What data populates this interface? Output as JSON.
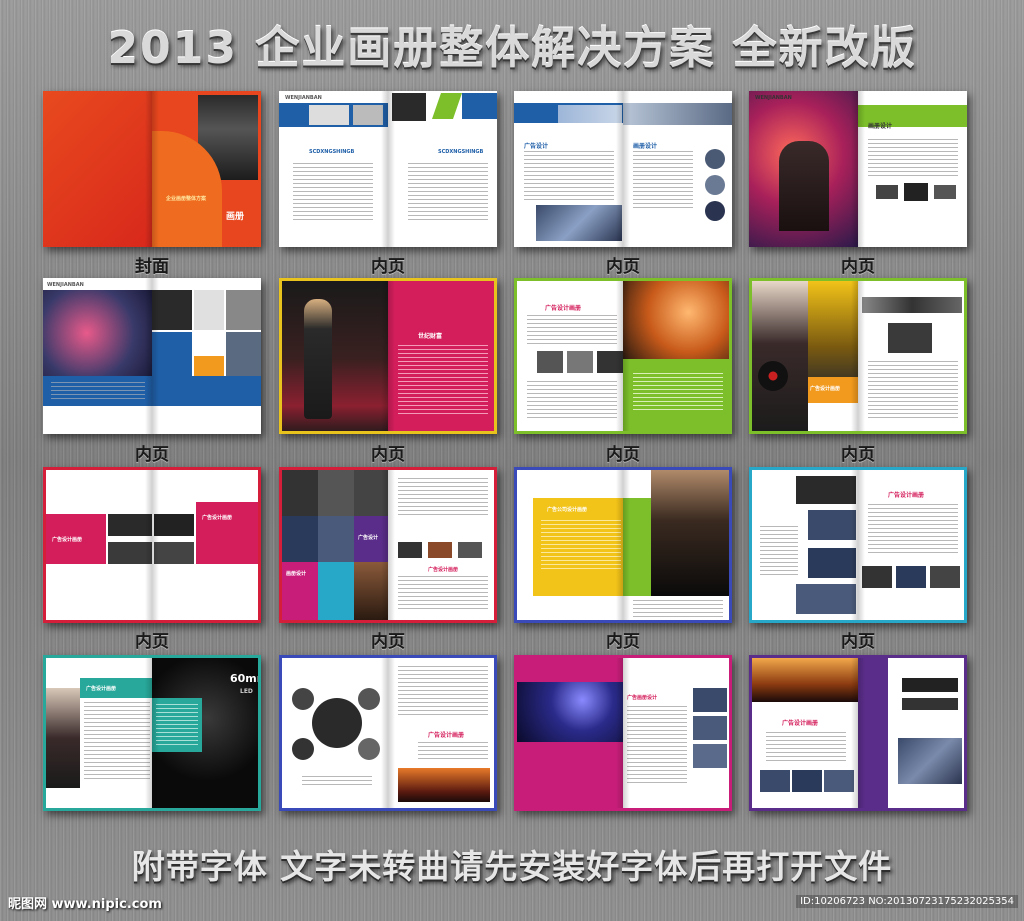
{
  "headline": "2013 企业画册整体解决方案  全新改版",
  "footer": "附带字体  文字未转曲请先安装好字体后再打开文件",
  "watermark": {
    "left": "昵图网 www.nipic.com",
    "right": "ID:10206723 NO:20130723175232025354"
  },
  "captions": {
    "cover": "封面",
    "inner": "内页"
  },
  "texts": {
    "wenjianban": "WENJIANBAN",
    "scd": "SCDXNGSHINGB",
    "cover_brand": "画册",
    "cover_sub": "企业画册整体方案",
    "ad_design": "广告设计",
    "ad_album": "广告设计画册",
    "century": "世纪财富",
    "ad_company": "广告公司设计画册",
    "ad_album_design": "广告画册设计",
    "sixty_mm": "60mm",
    "led": "LED",
    "new_design": "画册设计",
    "design_small": "画册设计"
  },
  "colors": {
    "orange_red": "#e8461e",
    "blue": "#1f5fa8",
    "green": "#7cbf2a",
    "magenta": "#d41e5c",
    "purple": "#5a2d8a",
    "teal": "#27a89a",
    "yellow": "#f2c318",
    "pink": "#c81e7a"
  }
}
